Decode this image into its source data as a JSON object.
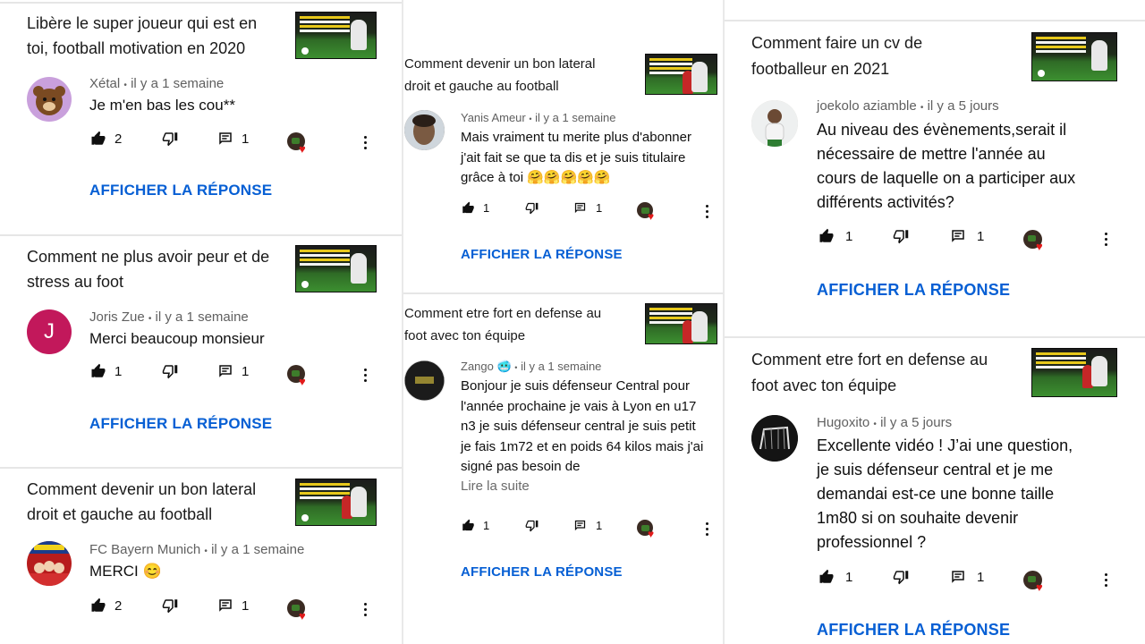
{
  "columns": [
    {
      "cards": [
        {
          "video_title": "Libère le super joueur qui est en toi, football motivation en 2020",
          "author": "Xétal",
          "sep": "•",
          "time": "il y a 1 semaine",
          "comment": "Je m'en bas les cou**",
          "likes": "2",
          "replies": "1",
          "reply_button": "AFFICHER LA RÉPONSE",
          "avatar_letter": "",
          "avatar_color": "#c9a0dc"
        },
        {
          "video_title": "Comment ne plus avoir peur et de stress au foot",
          "author": "Joris Zue",
          "sep": "•",
          "time": "il y a 1 semaine",
          "comment": "Merci beaucoup monsieur",
          "likes": "1",
          "replies": "1",
          "reply_button": "AFFICHER LA RÉPONSE",
          "avatar_letter": "J",
          "avatar_color": "#c2185b"
        },
        {
          "video_title": "Comment devenir un bon lateral droit et gauche au football",
          "author": "FC Bayern Munich",
          "sep": "•",
          "time": "il y a 1 semaine",
          "comment": "MERCI 😊",
          "likes": "2",
          "replies": "1",
          "reply_button": "AFFICHER LA RÉPONSE",
          "avatar_letter": "",
          "avatar_color": "#b71c1c"
        }
      ]
    },
    {
      "cards": [
        {
          "video_title": "Comment devenir un bon lateral droit et gauche au football",
          "author": "Yanis Ameur",
          "sep": "•",
          "time": "il y a 1 semaine",
          "comment": "Mais vraiment tu merite plus d'abonner j'ait fait se que ta dis et je suis titulaire grâce à toi 🤗🤗🤗🤗🤗",
          "likes": "1",
          "replies": "1",
          "reply_button": "AFFICHER LA RÉPONSE",
          "avatar_letter": "",
          "avatar_color": "#6d5a4a"
        },
        {
          "video_title": "Comment etre fort en defense au foot avec ton équipe",
          "author": "Zango 🥶",
          "sep": "•",
          "time": "il y a 1 semaine",
          "comment": "Bonjour je suis défenseur Central pour l'année prochaine je vais à Lyon en u17 n3 je suis défenseur central je suis petit je fais 1m72 et en poids 64 kilos mais j'ai signé pas besoin de",
          "read_more": "Lire la suite",
          "likes": "1",
          "replies": "1",
          "reply_button": "AFFICHER LA RÉPONSE",
          "avatar_letter": "",
          "avatar_color": "#222222"
        }
      ]
    },
    {
      "cards": [
        {
          "video_title": "Comment faire un cv de footballeur en 2021",
          "author": "joekolo aziamble",
          "sep": "•",
          "time": "il y a 5 jours",
          "comment": "Au niveau des évènements,serait il nécessaire de mettre l'année au cours de laquelle on a participer aux différents activités?",
          "likes": "1",
          "replies": "1",
          "reply_button": "AFFICHER LA RÉPONSE",
          "avatar_letter": "",
          "avatar_color": "#d8d0c4"
        },
        {
          "video_title": "Comment etre fort en defense au foot avec ton équipe",
          "author": "Hugoxito",
          "sep": "•",
          "time": "il y a 5 jours",
          "comment": "Excellente vidéo ! J’ai une question, je suis défenseur central et je me demandai est-ce une bonne taille 1m80 si on souhaite devenir professionnel ?",
          "likes": "1",
          "replies": "1",
          "reply_button": "AFFICHER LA RÉPONSE",
          "avatar_letter": "",
          "avatar_color": "#141414"
        }
      ]
    }
  ],
  "icons": {
    "like": "thumb-up-icon",
    "dislike": "thumb-down-icon",
    "reply": "comment-reply-icon",
    "heart": "creator-heart-icon",
    "more": "more-vert-icon"
  },
  "colors": {
    "link": "#065fd4",
    "meta": "#606060",
    "heart": "#e21b1b"
  }
}
